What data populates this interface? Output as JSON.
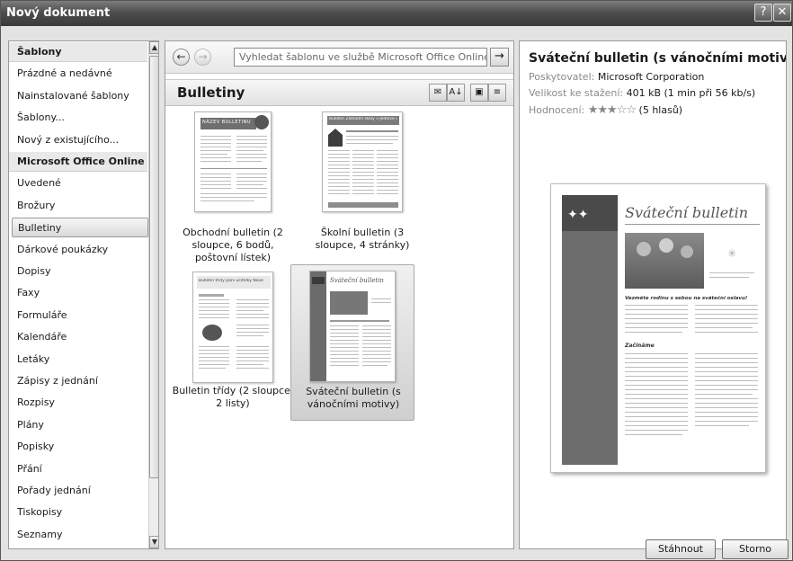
{
  "window": {
    "title": "Nový dokument",
    "help_glyph": "?",
    "close_glyph": "✕"
  },
  "sidebar": {
    "items": [
      {
        "label": "Šablony",
        "kind": "header"
      },
      {
        "label": "Prázdné a nedávné",
        "kind": "item"
      },
      {
        "label": "Nainstalované šablony",
        "kind": "item"
      },
      {
        "label": "Šablony...",
        "kind": "item"
      },
      {
        "label": "Nový z existujícího...",
        "kind": "item"
      },
      {
        "label": "Microsoft Office Online",
        "kind": "header"
      },
      {
        "label": "Uvedené",
        "kind": "item"
      },
      {
        "label": "Brožury",
        "kind": "item"
      },
      {
        "label": "Bulletiny",
        "kind": "selected"
      },
      {
        "label": "Dárkové poukázky",
        "kind": "item"
      },
      {
        "label": "Dopisy",
        "kind": "item"
      },
      {
        "label": "Faxy",
        "kind": "item"
      },
      {
        "label": "Formuláře",
        "kind": "item"
      },
      {
        "label": "Kalendáře",
        "kind": "item"
      },
      {
        "label": "Letáky",
        "kind": "item"
      },
      {
        "label": "Zápisy z jednání",
        "kind": "item"
      },
      {
        "label": "Rozpisy",
        "kind": "item"
      },
      {
        "label": "Plány",
        "kind": "item"
      },
      {
        "label": "Popisky",
        "kind": "item"
      },
      {
        "label": "Přání",
        "kind": "item"
      },
      {
        "label": "Pořady jednání",
        "kind": "item"
      },
      {
        "label": "Tiskopisy",
        "kind": "item"
      },
      {
        "label": "Seznamy",
        "kind": "item"
      }
    ]
  },
  "search": {
    "placeholder": "Vyhledat šablonu ve službě Microsoft Office Online"
  },
  "section": {
    "title": "Bulletiny"
  },
  "templates": [
    {
      "label": "Obchodní bulletin (2 sloupce, 6 bodů, poštovní lístek)",
      "doc_heading": "Název bulletinu"
    },
    {
      "label": "Školní bulletin (3 sloupce, 4 stránky)",
      "doc_heading": "Bulletin Základní školy v Jedlové ulici"
    },
    {
      "label": "Bulletin třídy (2 sloupce, 2 listy)",
      "doc_heading": "Bulletin třídy paní učitelky Nové"
    },
    {
      "label": "Sváteční bulletin (s vánočními motivy)",
      "doc_heading": "Sváteční bulletin",
      "selected": true
    }
  ],
  "details": {
    "title": "Sváteční bulletin (s vánočními motivy)",
    "provider_label": "Poskytovatel:",
    "provider_value": "Microsoft Corporation",
    "size_label": "Velikost ke stažení:",
    "size_value": "401 kB (1 min při 56 kb/s)",
    "rating_label": "Hodnocení:",
    "rating_stars": "★★★☆☆",
    "rating_count": "(5 hlasů)",
    "preview_heading": "Sváteční bulletin",
    "preview_subheading": "Vezměte rodinu s sebou na sváteční oslavu!",
    "preview_section": "Začínáme"
  },
  "buttons": {
    "download": "Stáhnout",
    "cancel": "Storno"
  }
}
